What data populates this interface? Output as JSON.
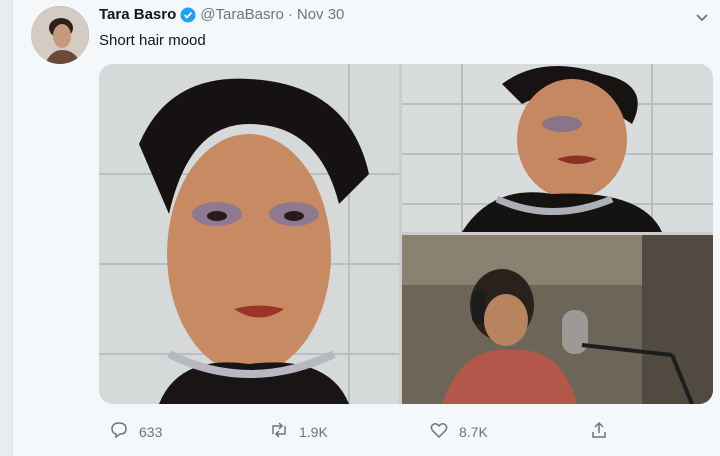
{
  "tweet": {
    "name": "Tara Basro",
    "handle": "@TaraBasro",
    "separator": "·",
    "date": "Nov 30",
    "text": "Short hair mood"
  },
  "actions": {
    "replies": "633",
    "retweets": "1.9K",
    "likes": "8.7K"
  },
  "icons": [
    "verified-badge-icon",
    "chevron-down-icon",
    "reply-icon",
    "retweet-icon",
    "like-icon",
    "share-icon"
  ],
  "colors": {
    "accent": "#1da1f2",
    "muted": "#657786",
    "text": "#14171a"
  }
}
